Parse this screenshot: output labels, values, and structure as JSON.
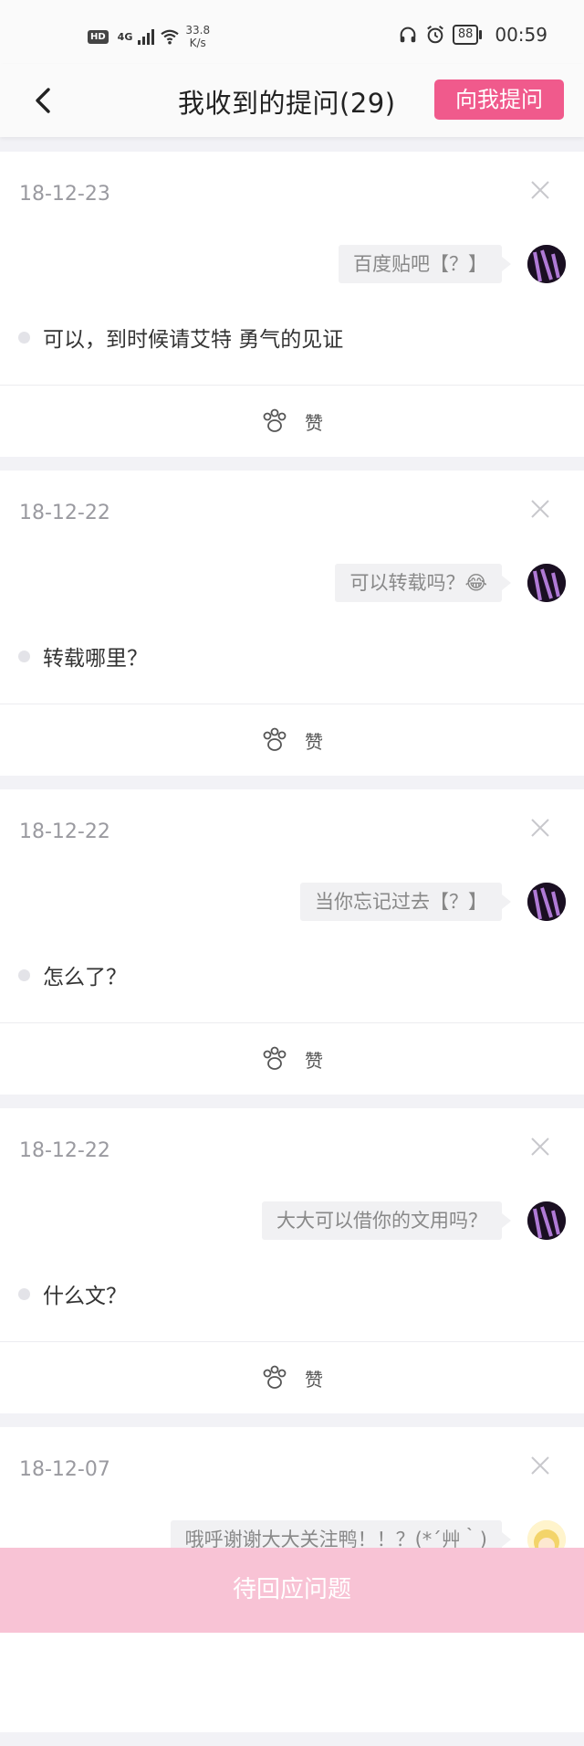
{
  "status_bar": {
    "hd": "HD",
    "network": "4G",
    "speed_value": "33.8",
    "speed_unit": "K/s",
    "battery": "88",
    "time": "00:59"
  },
  "header": {
    "title": "我收到的提问(29)",
    "ask_button": "向我提问"
  },
  "like_label": "赞",
  "cards": [
    {
      "date": "18-12-23",
      "question": "百度贴吧【？】",
      "answer": "可以，到时候请艾特 勇气的见证"
    },
    {
      "date": "18-12-22",
      "question": "可以转载吗？😂",
      "answer": "转载哪里？"
    },
    {
      "date": "18-12-22",
      "question": "当你忘记过去【？】",
      "answer": "怎么了？"
    },
    {
      "date": "18-12-22",
      "question": "大大可以借你的文用吗？",
      "answer": "什么文？"
    },
    {
      "date": "18-12-07",
      "question": "哦呼谢谢大大关注鸭！！？(*´艸｀)",
      "answer": ""
    }
  ],
  "bottom_bar": {
    "label": "待回应问题"
  },
  "colors": {
    "accent": "#f05a8c",
    "bottom_bar": "#f8c3d5",
    "background": "#f2f2f6"
  }
}
